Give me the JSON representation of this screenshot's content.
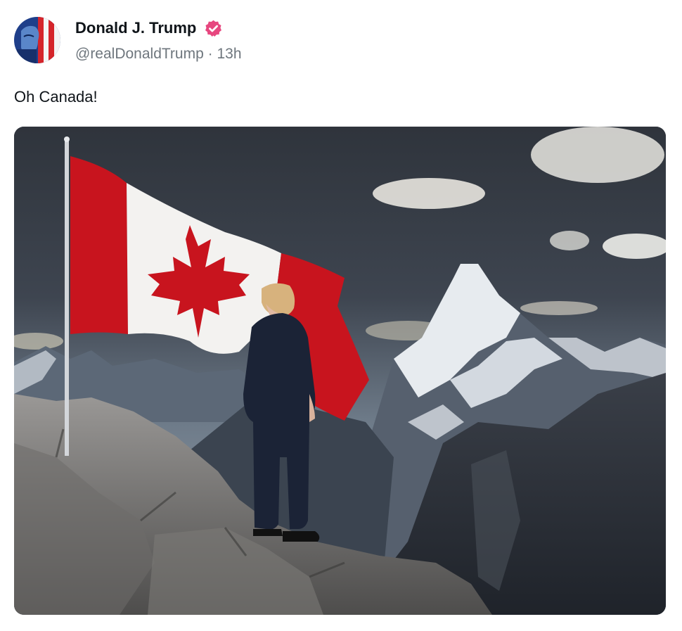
{
  "post": {
    "author_name": "Donald J. Trump",
    "author_handle": "@realDonaldTrump",
    "separator": "·",
    "time": "13h",
    "verified_badge": "verified-check-icon",
    "text": "Oh Canada!"
  },
  "media": {
    "description_icon": "image"
  },
  "colors": {
    "verified": "#e7477f",
    "flag_red": "#c8141e",
    "handle_gray": "#6e767d"
  }
}
